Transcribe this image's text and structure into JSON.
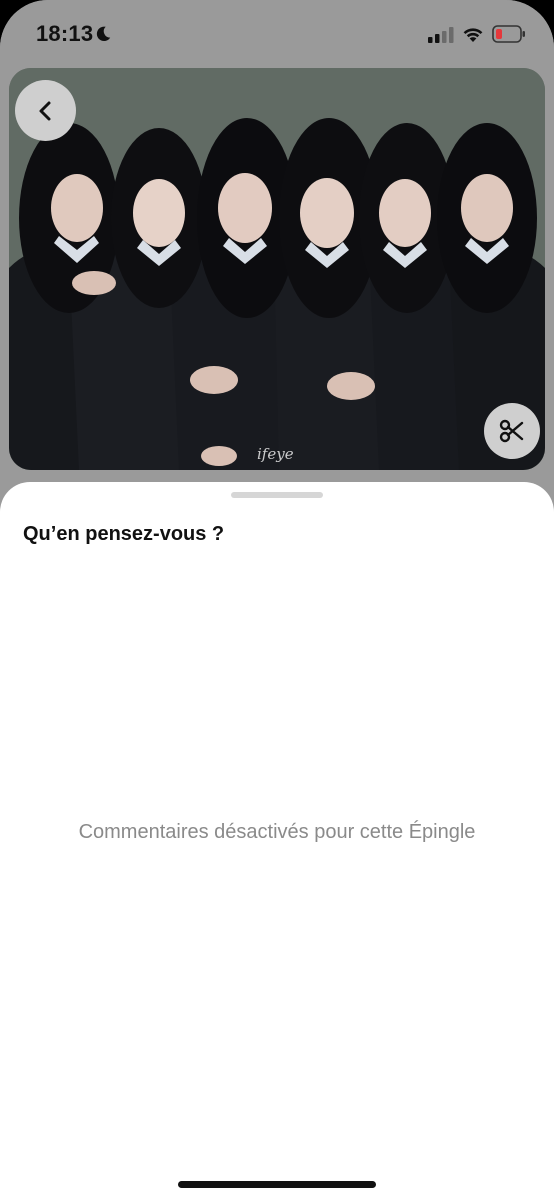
{
  "status_bar": {
    "time": "18:13",
    "icons": [
      "moon-icon",
      "cellular-signal-icon",
      "wifi-icon",
      "battery-low-icon"
    ],
    "battery_color": "#e5383b"
  },
  "pin": {
    "image_description_icon": "group-photo",
    "watermark": "ifeye",
    "back_icon": "chevron-left-icon",
    "crop_icon": "scissors-icon"
  },
  "comments_sheet": {
    "title": "Qu’en pensez-vous ?",
    "empty_message": "Commentaires désactivés pour cette Épingle"
  },
  "colors": {
    "overlay": "#9a9a9a",
    "sheet_bg": "#ffffff",
    "muted_text": "#8a8a8a"
  }
}
